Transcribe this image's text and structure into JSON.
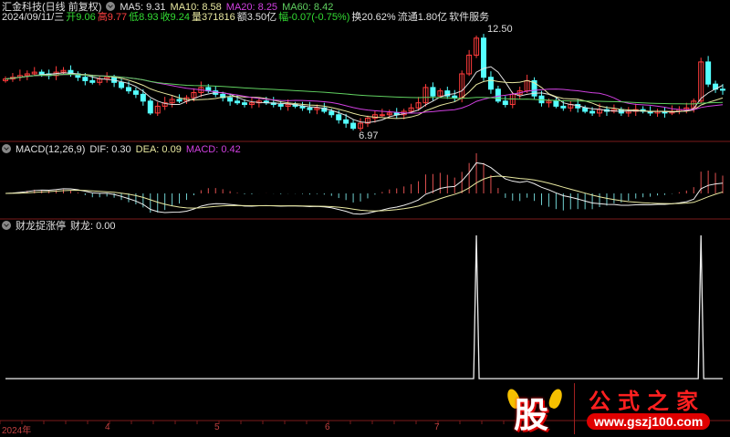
{
  "header": {
    "title": "汇金科技(日线 前复权)",
    "ma": [
      {
        "label": "MA5: 9.31",
        "color": "#e0e0e0"
      },
      {
        "label": "MA10: 8.58",
        "color": "#e8e8a0"
      },
      {
        "label": "MA20: 8.25",
        "color": "#d040e0"
      },
      {
        "label": "MA60: 8.42",
        "color": "#60d060"
      }
    ]
  },
  "quote": {
    "date": "2024/09/11/三",
    "open": "开9.06",
    "high": "高9.77",
    "low": "低8.93",
    "close": "收9.24",
    "volume": "量371816",
    "amount": "额3.50亿",
    "change": "幅-0.07(-0.75%)",
    "turnover": "换20.62%",
    "float": "流通1.80亿",
    "sector": "软件服务"
  },
  "main": {
    "max_label": "12.50",
    "min_label": "6.97"
  },
  "macd": {
    "title": "MACD(12,26,9)",
    "dif": "DIF: 0.30",
    "dea": "DEA: 0.09",
    "macd": "MACD: 0.42"
  },
  "indicator": {
    "title": "财龙捉涨停",
    "value": "财龙: 0.00"
  },
  "xaxis": [
    "2024年",
    "4",
    "5",
    "6",
    "7"
  ],
  "logo": {
    "char": "股",
    "site": "公式之家",
    "url": "www.gszj100.com"
  },
  "chart_data": {
    "type": "candlestick",
    "closes": [
      9.9,
      10.0,
      10.1,
      10.2,
      10.3,
      10.2,
      10.1,
      10.3,
      10.4,
      10.2,
      10.0,
      9.8,
      9.7,
      9.9,
      10.0,
      9.7,
      9.4,
      9.2,
      9.0,
      8.6,
      7.9,
      8.3,
      8.5,
      8.7,
      8.6,
      8.8,
      9.1,
      9.4,
      9.2,
      9.0,
      8.8,
      8.6,
      8.5,
      8.4,
      8.5,
      8.6,
      8.5,
      8.4,
      8.3,
      8.4,
      8.3,
      8.2,
      8.1,
      8.2,
      8.0,
      7.8,
      7.5,
      7.3,
      7.0,
      7.3,
      7.6,
      7.8,
      7.8,
      7.9,
      7.8,
      8.0,
      8.2,
      8.5,
      9.4,
      8.9,
      9.2,
      8.9,
      8.8,
      10.2,
      11.3,
      12.3,
      10.0,
      9.3,
      8.6,
      8.4,
      9.0,
      9.2,
      9.8,
      8.9,
      8.5,
      8.6,
      8.3,
      8.2,
      8.4,
      8.2,
      8.0,
      7.9,
      8.1,
      8.0,
      8.1,
      7.9,
      8.0,
      8.1,
      8.0,
      7.9,
      8.0,
      7.9,
      8.0,
      8.1,
      8.2,
      8.6,
      10.9,
      9.6,
      9.3,
      9.24
    ],
    "signals": [
      65,
      96
    ],
    "price_range": [
      6.5,
      13.2
    ]
  }
}
